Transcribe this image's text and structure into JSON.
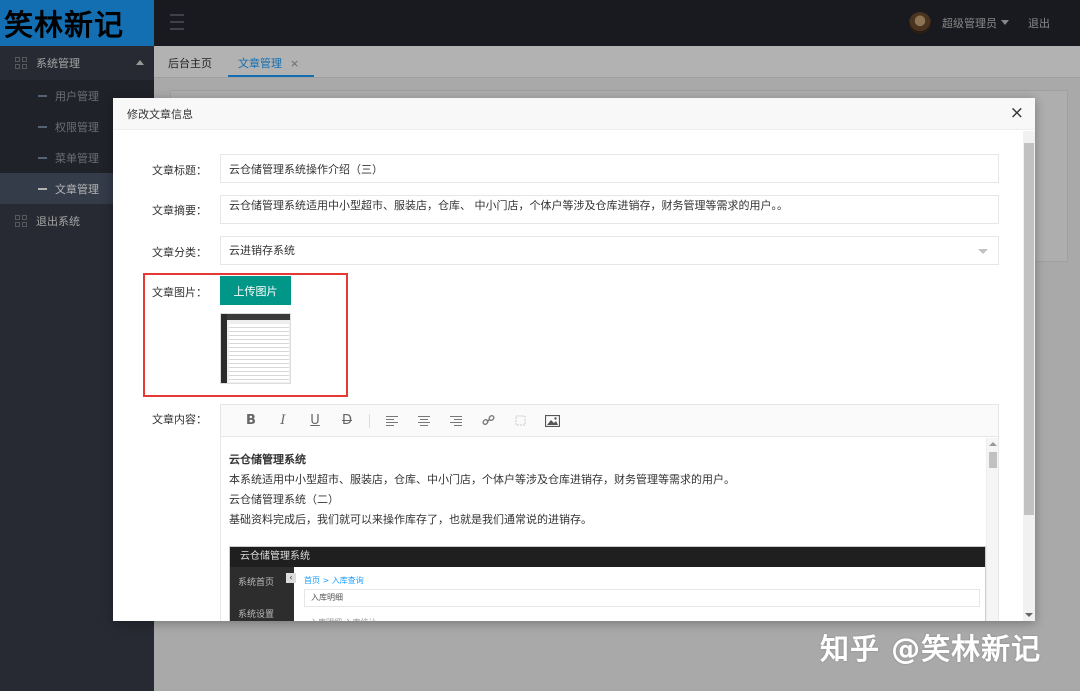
{
  "brand": {
    "logo_text": "笑林新记"
  },
  "header": {
    "user_name": "超级管理员",
    "logout_label": "退出"
  },
  "sidebar": {
    "group_label": "系统管理",
    "items": [
      {
        "label": "用户管理"
      },
      {
        "label": "权限管理"
      },
      {
        "label": "菜单管理"
      },
      {
        "label": "文章管理"
      }
    ],
    "exit_label": "退出系统"
  },
  "tabs": [
    {
      "label": "后台主页"
    },
    {
      "label": "文章管理",
      "close": "×"
    }
  ],
  "modal": {
    "title": "修改文章信息",
    "close_glyph": "×",
    "form": {
      "title_label": "文章标题：",
      "title_value": "云仓储管理系统操作介绍（三）",
      "summary_label": "文章摘要：",
      "summary_value": "云仓储管理系统适用中小型超市、服装店，仓库、 中小门店，个体户等涉及仓库进销存，财务管理等需求的用户。。",
      "category_label": "文章分类：",
      "category_value": "云进销存系统",
      "image_label": "文章图片：",
      "upload_label": "上传图片",
      "content_label": "文章内容："
    },
    "editor": {
      "toolbar": [
        "B",
        "I",
        "U",
        "D"
      ],
      "content": {
        "heading": "云仓储管理系统",
        "p1": "本系统适用中小型超市、服装店，仓库、中小门店，个体户等涉及仓库进销存，财务管理等需求的用户。",
        "p2": "云仓储管理系统（二）",
        "p3": "基础资料完成后，我们就可以来操作库存了，也就是我们通常说的进销存。"
      },
      "embedded_screenshot": {
        "header": "云仓储管理系统",
        "crumb": "首页 > 入库查询",
        "side_items": [
          "系统首页",
          "系统设置"
        ],
        "panel_title": "入库明细",
        "tabs": "入库明细    入库统计"
      }
    }
  },
  "watermark": "知乎 @笑林新记"
}
